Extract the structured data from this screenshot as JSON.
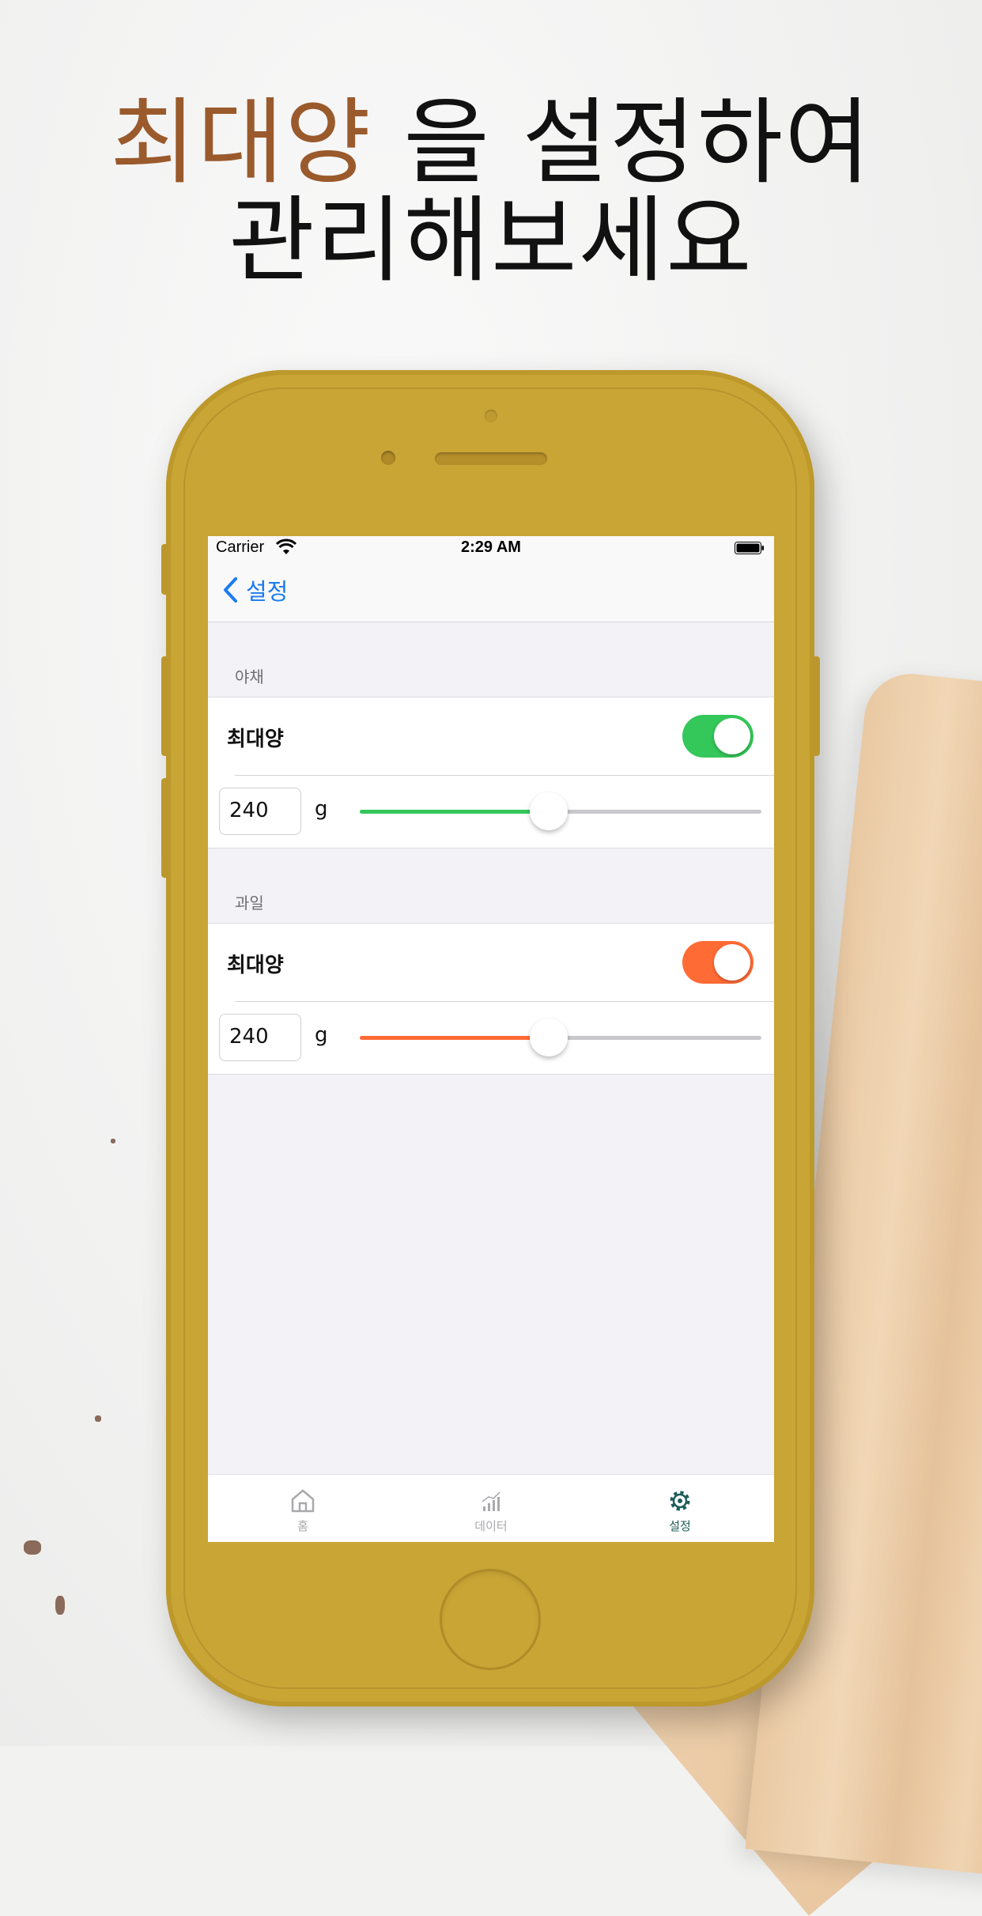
{
  "headline": {
    "accent": "최대양",
    "line1_rest": " 을 설정하여",
    "line2": "관리해보세요"
  },
  "status_bar": {
    "carrier": "Carrier",
    "time": "2:29 AM"
  },
  "nav": {
    "back_label": "설정"
  },
  "sections": [
    {
      "header": "야채",
      "row_label": "최대양",
      "toggle_on": true,
      "accent_color": "#34c759",
      "quantity": "240",
      "unit": "g",
      "slider_fraction": 0.47
    },
    {
      "header": "과일",
      "row_label": "최대양",
      "toggle_on": true,
      "accent_color": "#ff6b35",
      "quantity": "240",
      "unit": "g",
      "slider_fraction": 0.47
    }
  ],
  "tabs": [
    {
      "label": "홈",
      "icon": "house-icon",
      "active": false
    },
    {
      "label": "데이터",
      "icon": "chart-icon",
      "active": false
    },
    {
      "label": "설정",
      "icon": "gear-icon",
      "active": true
    }
  ],
  "colors": {
    "accent_text": "#9a5a2c",
    "phone_body": "#c9a535",
    "ios_blue": "#1a7cf0",
    "tab_active": "#1f5e5a",
    "tab_inactive": "#a9a9ad"
  }
}
